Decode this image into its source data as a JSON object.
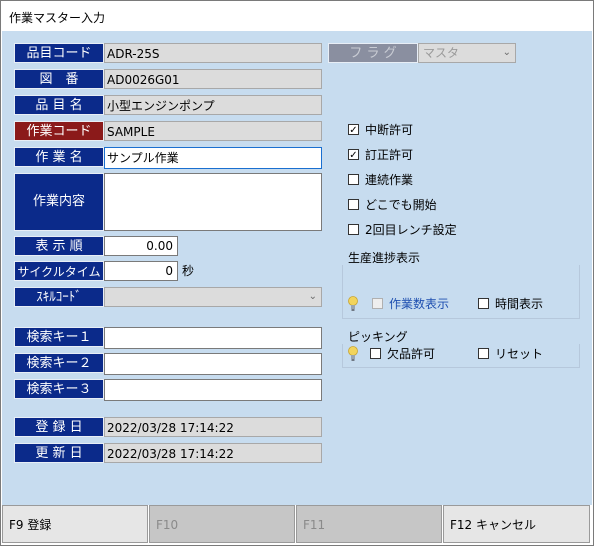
{
  "window": {
    "title": "作業マスター入力"
  },
  "form": {
    "item_code": {
      "label": "品目コード",
      "value": "ADR-25S"
    },
    "drawing_no": {
      "label": "図　番",
      "value": "AD0026G01"
    },
    "item_name": {
      "label": "品 目 名",
      "value": "小型エンジンポンプ"
    },
    "work_code": {
      "label": "作業コード",
      "value": "SAMPLE"
    },
    "work_name": {
      "label": "作 業 名",
      "value": "サンプル作業"
    },
    "work_content": {
      "label": "作業内容",
      "value": ""
    },
    "display_order": {
      "label": "表 示 順",
      "value": "0.00"
    },
    "cycle_time": {
      "label": "サイクルタイム",
      "value": "0",
      "unit": "秒"
    },
    "skill_code": {
      "label": "ｽｷﾙｺｰﾄﾞ",
      "value": ""
    },
    "search_key1": {
      "label": "検索キー１",
      "value": ""
    },
    "search_key2": {
      "label": "検索キー２",
      "value": ""
    },
    "search_key3": {
      "label": "検索キー３",
      "value": ""
    },
    "registered": {
      "label": "登 録 日",
      "value": "2022/03/28 17:14:22"
    },
    "updated": {
      "label": "更 新 日",
      "value": "2022/03/28 17:14:22"
    },
    "flag": {
      "label": "フ ラ グ",
      "value": "マスタ"
    }
  },
  "options": {
    "interrupt_allowed": {
      "label": "中断許可",
      "checked": true
    },
    "correction_allowed": {
      "label": "訂正許可",
      "checked": true
    },
    "continuous_work": {
      "label": "連続作業",
      "checked": false
    },
    "start_anywhere": {
      "label": "どこでも開始",
      "checked": false
    },
    "second_wrench": {
      "label": "2回目レンチ設定",
      "checked": false
    }
  },
  "progress_display": {
    "title": "生産進捗表示",
    "work_count": {
      "label": "作業数表示",
      "checked": false,
      "disabled": true
    },
    "time_display": {
      "label": "時間表示",
      "checked": false
    }
  },
  "picking": {
    "title": "ピッキング",
    "shortage_allowed": {
      "label": "欠品許可",
      "checked": false
    },
    "reset": {
      "label": "リセット",
      "checked": false
    }
  },
  "footer": {
    "f9": "F9 登録",
    "f10": "F10",
    "f11": "F11",
    "f12": "F12 キャンセル"
  },
  "icons": {
    "bulb": "lightbulb-icon",
    "chevron": "chevron-down-icon",
    "check": "checkmark-icon"
  },
  "colors": {
    "label_bg": "#0b2a8a",
    "label_key_bg": "#8b1a1a",
    "client_bg": "#c7dcef"
  }
}
